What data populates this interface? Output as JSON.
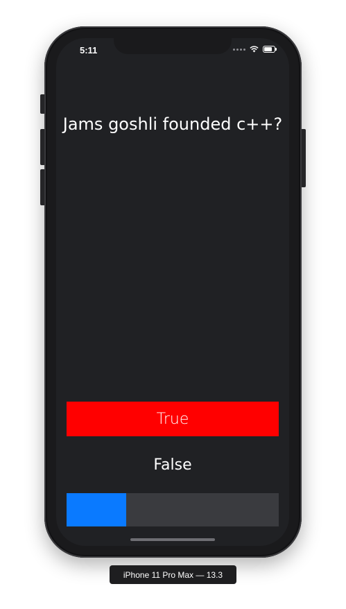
{
  "status_bar": {
    "time": "5:11",
    "icons": [
      "signal-dots-icon",
      "wifi-icon",
      "battery-icon"
    ]
  },
  "quiz": {
    "question": "Jams goshli founded c++?",
    "true_label": "True",
    "false_label": "False",
    "progress": 0.28
  },
  "colors": {
    "background": "#202124",
    "true_button": "#ff0000",
    "progress_fill": "#0a7aff",
    "progress_track": "#3a3b3f"
  },
  "simulator": {
    "device_label": "iPhone 11 Pro Max — 13.3"
  }
}
